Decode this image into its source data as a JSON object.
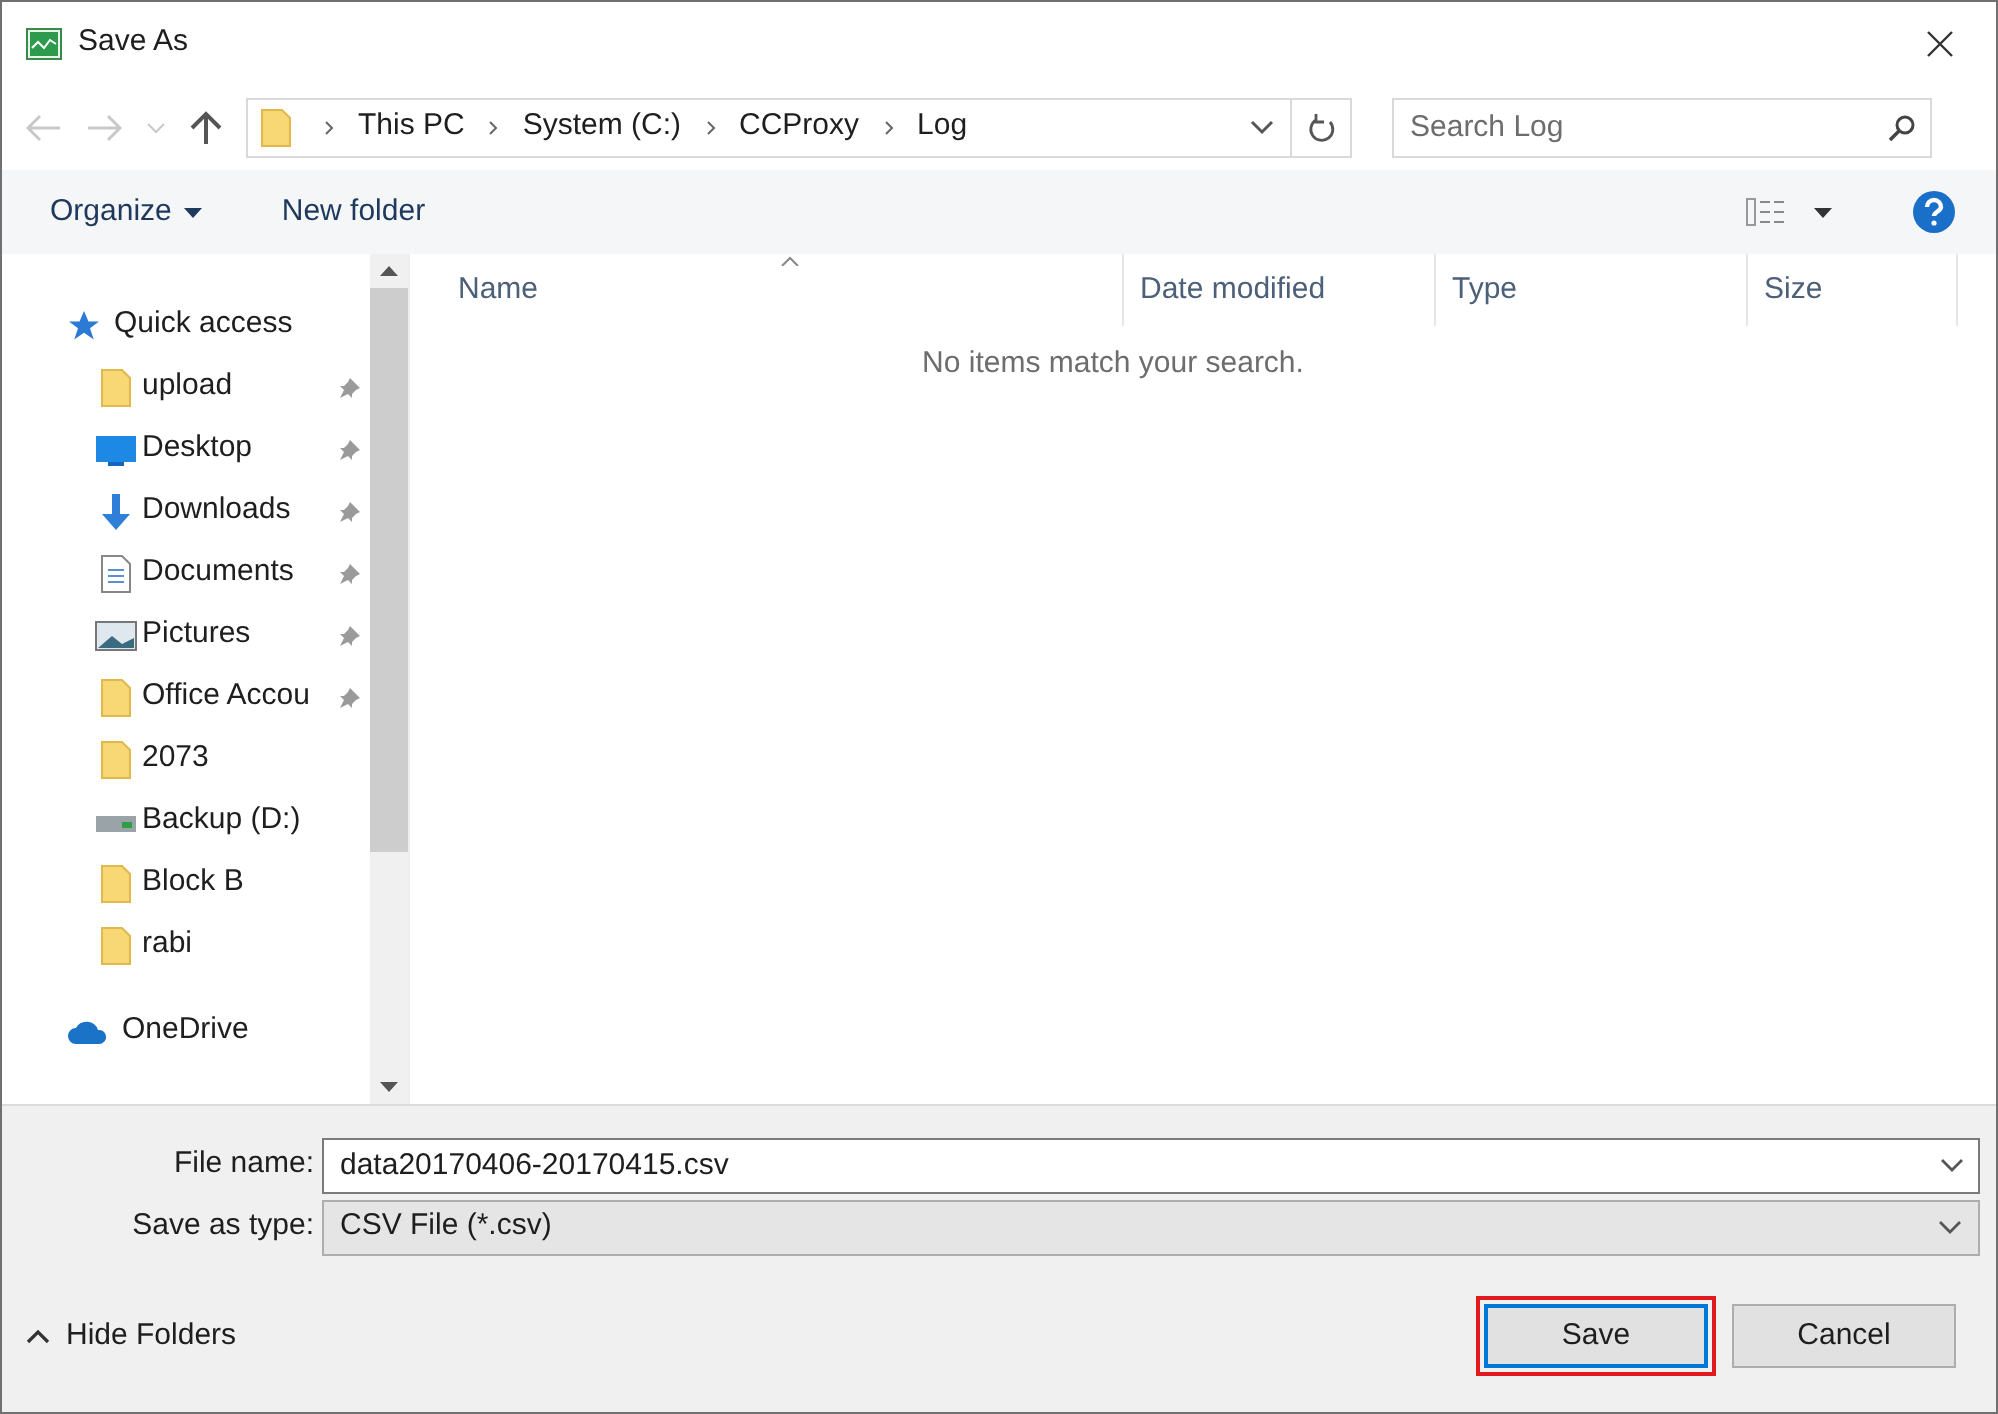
{
  "window": {
    "title": "Save As"
  },
  "breadcrumb": [
    "This PC",
    "System (C:)",
    "CCProxy",
    "Log"
  ],
  "search": {
    "placeholder": "Search Log"
  },
  "toolbar": {
    "organize": "Organize",
    "new_folder": "New folder"
  },
  "sidebar": {
    "sections": [
      {
        "label": "Quick access",
        "kind": "star",
        "children": [
          {
            "label": "upload",
            "kind": "folder",
            "pinned": true
          },
          {
            "label": "Desktop",
            "kind": "desktop",
            "pinned": true
          },
          {
            "label": "Downloads",
            "kind": "downloads",
            "pinned": true
          },
          {
            "label": "Documents",
            "kind": "documents",
            "pinned": true
          },
          {
            "label": "Pictures",
            "kind": "pictures",
            "pinned": true
          },
          {
            "label": "Office Accou",
            "kind": "folder",
            "pinned": true
          },
          {
            "label": "2073",
            "kind": "folder",
            "pinned": false
          },
          {
            "label": "Backup (D:)",
            "kind": "drive",
            "pinned": false
          },
          {
            "label": "Block B",
            "kind": "folder",
            "pinned": false
          },
          {
            "label": "rabi",
            "kind": "folder",
            "pinned": false
          }
        ]
      },
      {
        "label": "OneDrive",
        "kind": "cloud"
      }
    ]
  },
  "table": {
    "columns": [
      "Name",
      "Date modified",
      "Type",
      "Size"
    ],
    "empty_message": "No items match your search."
  },
  "form": {
    "file_name_label": "File name:",
    "file_name": "data20170406-20170415.csv",
    "type_label": "Save as type:",
    "type": "CSV File (*.csv)"
  },
  "hide_folders": "Hide Folders",
  "buttons": [
    {
      "label": "Save",
      "highlighted": true
    },
    {
      "label": "Cancel",
      "highlighted": false
    }
  ]
}
